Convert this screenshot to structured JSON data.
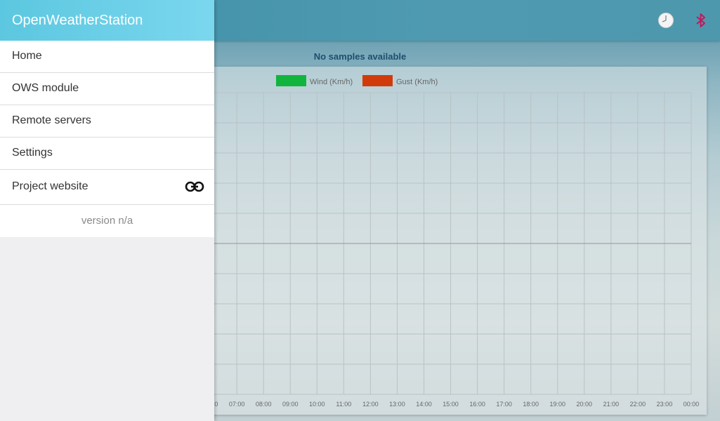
{
  "app": {
    "title": "OpenWeatherStation"
  },
  "drawer": {
    "items": [
      {
        "label": "Home"
      },
      {
        "label": "OWS module"
      },
      {
        "label": "Remote servers"
      },
      {
        "label": "Settings"
      },
      {
        "label": "Project website",
        "icon": "link-icon"
      }
    ],
    "version": "version n/a"
  },
  "topbar": {
    "icons": [
      "clock-icon",
      "bluetooth-icon"
    ],
    "bluetooth_color": "#c2185b"
  },
  "status": {
    "message": "No samples available"
  },
  "chart_data": {
    "type": "line",
    "series": [
      {
        "name": "Wind (Km/h)",
        "color": "#11b53d",
        "values": []
      },
      {
        "name": "Gust (Km/h)",
        "color": "#d13b0c",
        "values": []
      }
    ],
    "x_ticks": [
      "00:00",
      "07:00",
      "08:00",
      "09:00",
      "10:00",
      "11:00",
      "12:00",
      "13:00",
      "14:00",
      "15:00",
      "16:00",
      "17:00",
      "18:00",
      "19:00",
      "20:00",
      "21:00",
      "22:00",
      "23:00",
      "00:00"
    ],
    "legend": "top",
    "grid": true
  }
}
